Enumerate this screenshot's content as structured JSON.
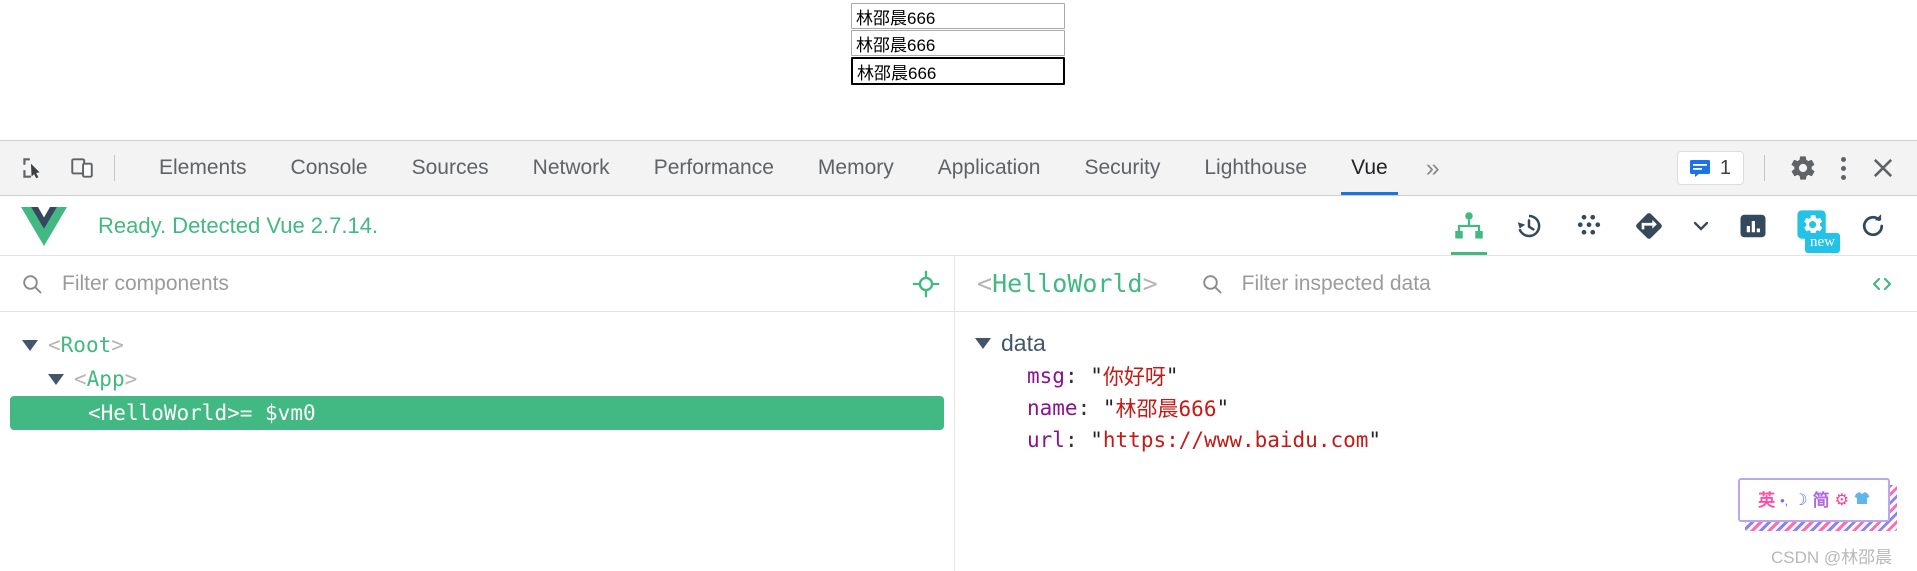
{
  "page": {
    "inputs": [
      {
        "name": "input-one",
        "value": "林邵晨666",
        "focused": false
      },
      {
        "name": "input-two",
        "value": "林邵晨666",
        "focused": false
      },
      {
        "name": "input-three",
        "value": "林邵晨666",
        "focused": true
      }
    ]
  },
  "devtools": {
    "tabs": [
      {
        "label": "Elements",
        "active": false
      },
      {
        "label": "Console",
        "active": false
      },
      {
        "label": "Sources",
        "active": false
      },
      {
        "label": "Network",
        "active": false
      },
      {
        "label": "Performance",
        "active": false
      },
      {
        "label": "Memory",
        "active": false
      },
      {
        "label": "Application",
        "active": false
      },
      {
        "label": "Security",
        "active": false
      },
      {
        "label": "Lighthouse",
        "active": false
      },
      {
        "label": "Vue",
        "active": true
      }
    ],
    "more_label": "»",
    "toolbar_icons": [
      {
        "name": "inspect-element-icon"
      },
      {
        "name": "device-toolbar-icon"
      }
    ],
    "messages_count": "1",
    "right_icons": [
      {
        "name": "messages-icon"
      },
      {
        "name": "settings-gear-icon"
      },
      {
        "name": "more-options-icon"
      },
      {
        "name": "close-devtools-icon"
      }
    ],
    "accent_color": "#1a73e8"
  },
  "vue_panel": {
    "status_text": "Ready. Detected Vue 2.7.14.",
    "logo_name": "vue-logo",
    "brand_color": "#42b883",
    "actions": [
      {
        "name": "components-tree-icon",
        "active": true
      },
      {
        "name": "timeline-history-icon",
        "active": false
      },
      {
        "name": "pinia-dots-icon",
        "active": false
      },
      {
        "name": "router-diamond-icon",
        "active": false
      },
      {
        "name": "chevron-down-icon",
        "active": false
      },
      {
        "name": "performance-chart-icon",
        "active": false
      },
      {
        "name": "new-devtools-gear-icon",
        "active": false,
        "badge": "new"
      },
      {
        "name": "refresh-icon",
        "active": false
      }
    ],
    "left": {
      "filter_placeholder": "Filter components",
      "filter_value": "",
      "select-on-page_icon": "target-crosshair-icon",
      "tree": [
        {
          "label": "Root",
          "open_bracket": "<",
          "close_bracket": ">",
          "indent": 0,
          "expanded": true,
          "selected": false,
          "suffix": ""
        },
        {
          "label": "App",
          "open_bracket": "<",
          "close_bracket": ">",
          "indent": 1,
          "expanded": true,
          "selected": false,
          "suffix": ""
        },
        {
          "label": "HelloWorld",
          "open_bracket": "<",
          "close_bracket": ">",
          "indent": 2,
          "expanded": false,
          "selected": true,
          "suffix": " = $vm0"
        }
      ]
    },
    "right": {
      "inspected_component": "HelloWorld",
      "open_bracket": "<",
      "close_bracket": ">",
      "filter_placeholder": "Filter inspected data",
      "filter_value": "",
      "code_icon": "open-in-editor-icon",
      "sections": [
        {
          "title": "data",
          "expanded": true,
          "entries": [
            {
              "key": "msg",
              "value": "你好呀"
            },
            {
              "key": "name",
              "value": "林邵晨666"
            },
            {
              "key": "url",
              "value": "https://www.baidu.com"
            }
          ]
        }
      ]
    }
  },
  "ime": {
    "items": [
      {
        "name": "ime-lang-chinese",
        "glyph": "英"
      },
      {
        "name": "ime-punctuation",
        "glyph": "•,"
      },
      {
        "name": "ime-moon-mode",
        "glyph": "☽"
      },
      {
        "name": "ime-simplified",
        "glyph": "简"
      },
      {
        "name": "ime-settings",
        "glyph": "⚙"
      },
      {
        "name": "ime-skin",
        "glyph": "ὅ5"
      }
    ]
  },
  "watermark": {
    "text": "CSDN @林邵晨"
  }
}
